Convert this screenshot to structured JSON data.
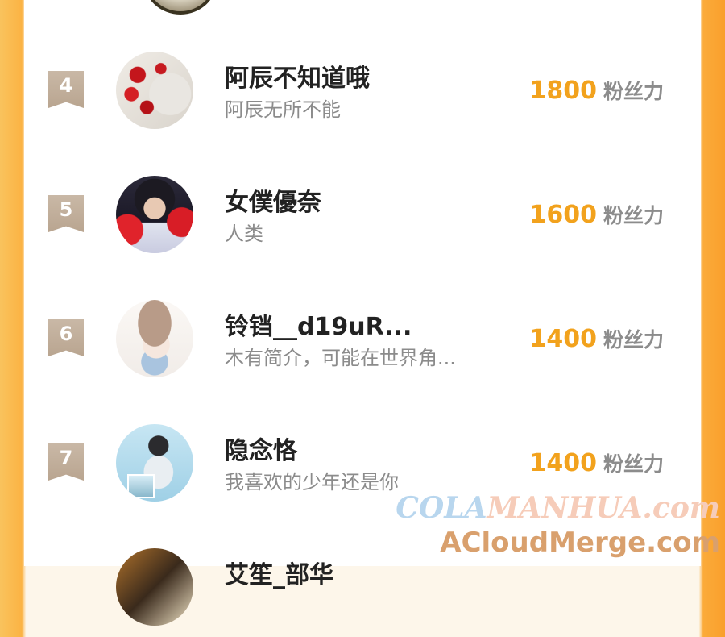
{
  "entries": [
    {
      "rank": "4",
      "name": "阿辰不知道哦",
      "bio": "阿辰无所不能",
      "score": "1800",
      "unit": "粉丝力"
    },
    {
      "rank": "5",
      "name": "女僕優奈",
      "bio": "人类",
      "score": "1600",
      "unit": "粉丝力"
    },
    {
      "rank": "6",
      "name": "铃铛__d19uR...",
      "bio": "木有简介，可能在世界角...",
      "score": "1400",
      "unit": "粉丝力"
    },
    {
      "rank": "7",
      "name": "隐念恪",
      "bio": "我喜欢的少年还是你",
      "score": "1400",
      "unit": "粉丝力"
    },
    {
      "name": "艾笙_部华"
    }
  ],
  "watermark": {
    "line1_prefix": "COLA",
    "line1_suffix": "MANHUA.com",
    "line2": "ACloudMerge.com"
  },
  "colors": {
    "accent": "#f2a21d",
    "badge": "#c4b19d",
    "frame": "#fbb344"
  }
}
